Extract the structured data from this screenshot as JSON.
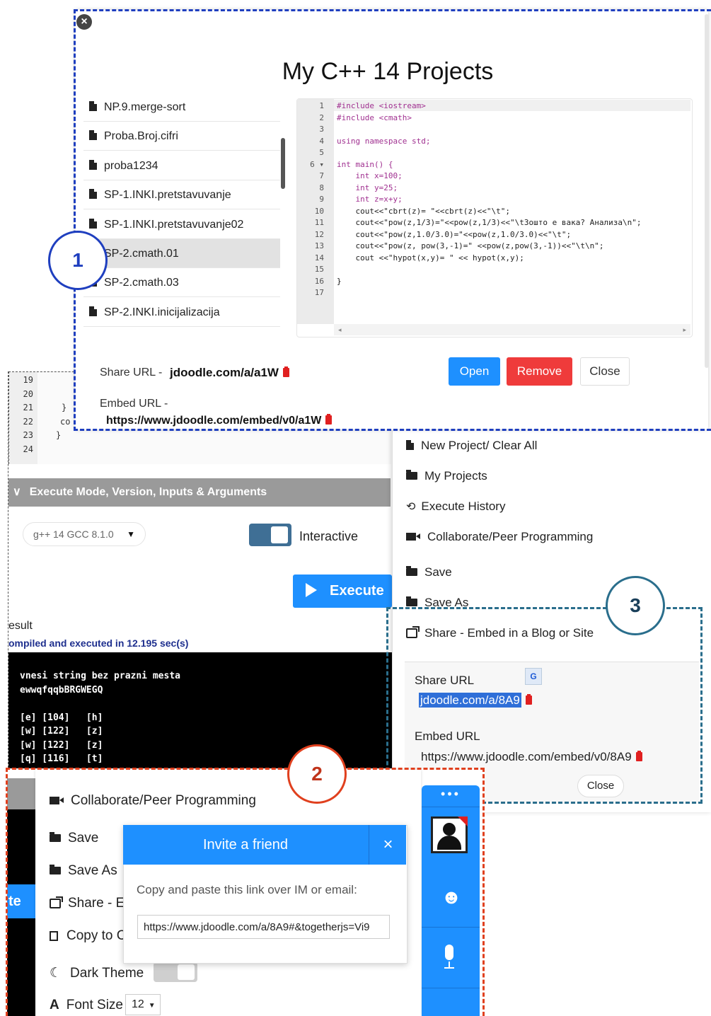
{
  "projects_modal": {
    "title": "My C++ 14 Projects",
    "projects": [
      "NP.9.merge-sort",
      "Proba.Broj.cifri",
      "proba1234",
      "SP-1.INKI.pretstavuvanje",
      "SP-1.INKI.pretstavuvanje02",
      "SP-2.cmath.01",
      "SP-2.cmath.03",
      "SP-2.INKI.inicijalizacija"
    ],
    "selected_project": "SP-2.cmath.01",
    "code_lines": [
      {
        "n": "1",
        "t": "#include <iostream>"
      },
      {
        "n": "2",
        "t": "#include <cmath>"
      },
      {
        "n": "3",
        "t": ""
      },
      {
        "n": "4",
        "t": "using namespace std;"
      },
      {
        "n": "5",
        "t": ""
      },
      {
        "n": "6 ▾",
        "t": "int main() {"
      },
      {
        "n": "7",
        "t": "    int x=100;"
      },
      {
        "n": "8",
        "t": "    int y=25;"
      },
      {
        "n": "9",
        "t": "    int z=x+y;"
      },
      {
        "n": "10",
        "t": "    cout<<\"cbrt(z)= \"<<cbrt(z)<<\"\\t\";"
      },
      {
        "n": "11",
        "t": "    cout<<\"pow(z,1/3)=\"<<pow(z,1/3)<<\"\\tЗошто е вака? Анализа\\n\";"
      },
      {
        "n": "12",
        "t": "    cout<<\"pow(z,1.0/3.0)=\"<<pow(z,1.0/3.0)<<\"\\t\";"
      },
      {
        "n": "13",
        "t": "    cout<<\"pow(z, pow(3,-1)=\" <<pow(z,pow(3,-1))<<\"\\t\\n\";"
      },
      {
        "n": "14",
        "t": "    cout <<\"hypot(x,y)= \" << hypot(x,y);"
      },
      {
        "n": "15",
        "t": ""
      },
      {
        "n": "16",
        "t": "}"
      },
      {
        "n": "17",
        "t": ""
      }
    ],
    "share_url_label": "Share URL -",
    "share_url": "jdoodle.com/a/a1W",
    "embed_url_label": "Embed URL -",
    "embed_url": "https://www.jdoodle.com/embed/v0/a1W",
    "open_label": "Open",
    "remove_label": "Remove",
    "close_label": "Close"
  },
  "editor_bg": {
    "line_numbers": [
      "19",
      "20",
      "21",
      "22",
      "23",
      "24"
    ],
    "code": [
      "",
      "",
      "}",
      "co",
      "}",
      ""
    ]
  },
  "execute_panel": {
    "header": "Execute Mode, Version, Inputs & Arguments",
    "version": "g++ 14 GCC 8.1.0",
    "interactive_label": "Interactive",
    "execute_label": "Execute",
    "result_label": "esult",
    "status": "ompiled and executed in 12.195 sec(s)",
    "terminal_lines": [
      "vnesi string bez prazni mesta",
      "ewwqfqqbBRGWEGQ",
      "",
      "[e] [104]   [h]",
      "[w] [122]   [z]",
      "[w] [122]   [z]",
      "[q] [116]   [t]"
    ]
  },
  "side_menu": {
    "items": [
      "New Project/ Clear All",
      "My Projects",
      "Execute History",
      "Collaborate/Peer Programming",
      "Save",
      "Save As",
      "Share - Embed in a Blog or Site"
    ]
  },
  "share_popup": {
    "share_url_label": "Share URL",
    "share_url": "jdoodle.com/a/8A9",
    "embed_url_label": "Embed URL",
    "embed_url": "https://www.jdoodle.com/embed/v0/8A9",
    "close_label": "Close"
  },
  "collab_panel": {
    "menu_items": [
      "Collaborate/Peer Programming",
      "Save",
      "Save As",
      "Share - E",
      "Copy to C",
      "Dark Theme",
      "Font Size"
    ],
    "font_size": "12",
    "left_tab": "te",
    "invite_title": "Invite a friend",
    "invite_close": "×",
    "invite_text": "Copy and paste this link over IM or email:",
    "invite_link": "https://www.jdoodle.com/a/8A9#&togetherjs=Vi9",
    "dots": "•••"
  },
  "callouts": {
    "one": "1",
    "two": "2",
    "three": "3"
  },
  "colors": {
    "blue_dash": "#1f3fbf",
    "red_dash": "#e0401e",
    "teal_dash": "#2a6e8c",
    "primary": "#1e90ff",
    "danger": "#ef3b3b"
  }
}
